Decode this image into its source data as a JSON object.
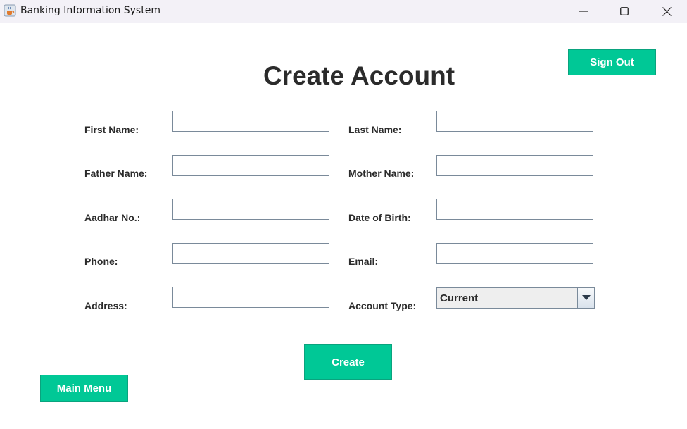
{
  "window": {
    "title": "Banking Information System",
    "icons": {
      "app": "java-coffee-icon",
      "minimize": "minimize-icon",
      "maximize": "maximize-icon",
      "close": "close-icon"
    }
  },
  "header": {
    "title": "Create Account",
    "sign_out_label": "Sign Out"
  },
  "form": {
    "labels": {
      "first_name": "First Name:",
      "last_name": "Last Name:",
      "father_name": "Father Name:",
      "mother_name": "Mother Name:",
      "aadhar": "Aadhar No.:",
      "dob": "Date of Birth:",
      "phone": "Phone:",
      "email": "Email:",
      "address": "Address:",
      "account_type": "Account Type:"
    },
    "values": {
      "first_name": "",
      "last_name": "",
      "father_name": "",
      "mother_name": "",
      "aadhar": "",
      "dob": "",
      "phone": "",
      "email": "",
      "address": ""
    },
    "account_type_selected": "Current",
    "create_label": "Create"
  },
  "footer": {
    "main_menu_label": "Main Menu"
  },
  "colors": {
    "accent": "#00c896",
    "title_bar": "#f3f1f7",
    "text": "#2b2b2b"
  }
}
